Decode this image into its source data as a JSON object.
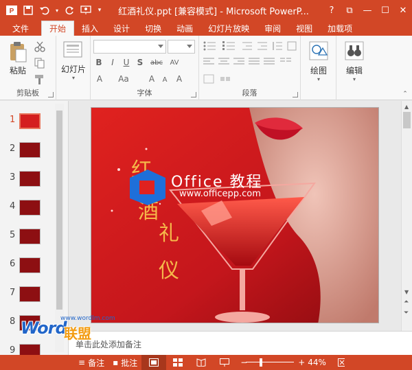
{
  "window": {
    "title": "红酒礼仪.ppt [兼容模式] - Microsoft PowerP...",
    "controls": [
      "?",
      "⧉",
      "—",
      "☐",
      "✕"
    ]
  },
  "tabs": [
    {
      "label": "文件"
    },
    {
      "label": "开始"
    },
    {
      "label": "插入"
    },
    {
      "label": "设计"
    },
    {
      "label": "切换"
    },
    {
      "label": "动画"
    },
    {
      "label": "幻灯片放映"
    },
    {
      "label": "审阅"
    },
    {
      "label": "视图"
    },
    {
      "label": "加载项"
    }
  ],
  "ribbon": {
    "clipboard": {
      "label": "剪贴板",
      "paste": "粘贴"
    },
    "slides": {
      "new_slide": "幻灯片"
    },
    "font": {
      "label": "字体"
    },
    "paragraph": {
      "label": "段落"
    },
    "drawing": {
      "label": "绘图"
    },
    "editing": {
      "label": "编辑"
    }
  },
  "thumbnails": [
    "1",
    "2",
    "3",
    "4",
    "5",
    "6",
    "7",
    "8",
    "9"
  ],
  "slide": {
    "title_chars": [
      "红",
      "酒",
      "礼",
      "仪"
    ],
    "logo_title": "Office 教程",
    "logo_url": "www.officepp.com"
  },
  "notes": {
    "placeholder": "单击此处添加备注"
  },
  "statusbar": {
    "notes": "备注",
    "comments": "批注",
    "zoom": "44%"
  },
  "watermark": {
    "word": "Word",
    "cn": "联盟",
    "url": "www.wordlm.com"
  },
  "colors": {
    "accent": "#d24726",
    "slide_red": "#c4161c"
  }
}
